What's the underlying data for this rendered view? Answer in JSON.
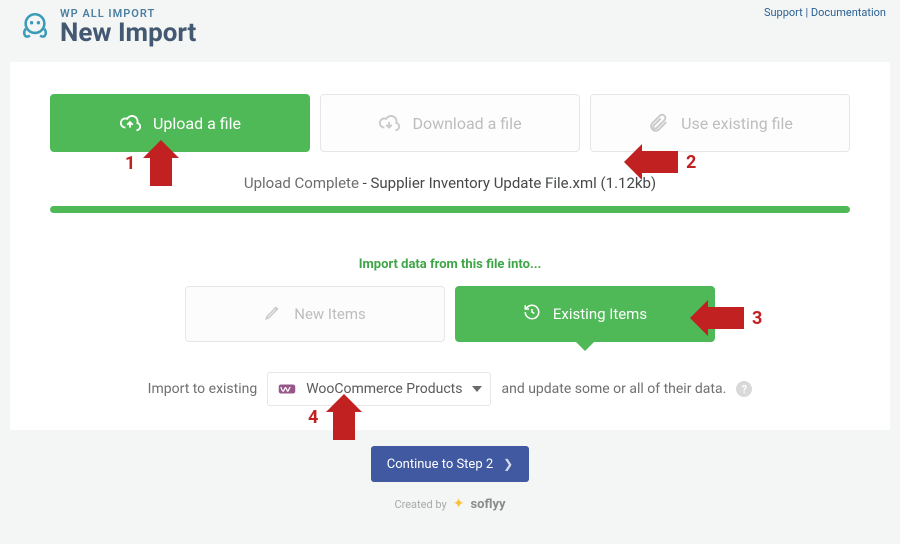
{
  "header": {
    "supertitle": "WP ALL IMPORT",
    "title": "New Import",
    "support": "Support",
    "documentation": "Documentation"
  },
  "source_buttons": {
    "upload": "Upload a file",
    "download": "Download a file",
    "existing": "Use existing file"
  },
  "upload_status": {
    "lead": "Upload Complete",
    "separator": " - ",
    "file": "Supplier Inventory Update File.xml (1.12kb)"
  },
  "section_heading": "Import data from this file into...",
  "mode_buttons": {
    "new_items": "New Items",
    "existing_items": "Existing Items"
  },
  "import_to": {
    "prefix": "Import to existing",
    "selected": "WooCommerce Products",
    "suffix": "and update some or all of their data."
  },
  "continue_label": "Continue to Step 2",
  "credit": {
    "lead": "Created by",
    "brand": "soflyy"
  },
  "annotations": {
    "n1": "1",
    "n2": "2",
    "n3": "3",
    "n4": "4"
  }
}
